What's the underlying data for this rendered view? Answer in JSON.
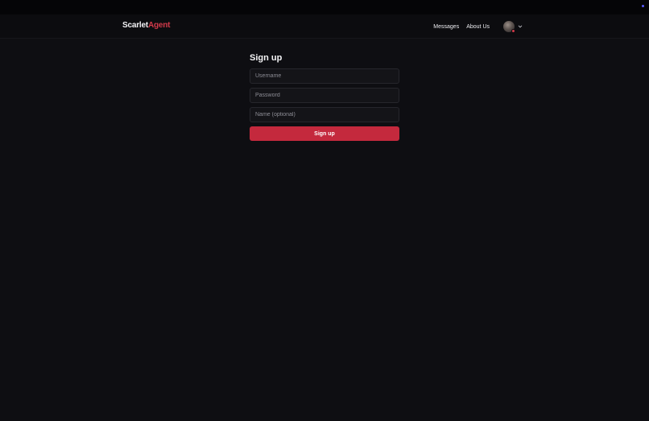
{
  "brand": {
    "part1": "Scarlet",
    "part2": "Agent"
  },
  "nav": {
    "messages": "Messages",
    "about": "About Us"
  },
  "signup": {
    "title": "Sign up",
    "username_placeholder": "Username",
    "password_placeholder": "Password",
    "name_placeholder": "Name (optional)",
    "submit_label": "Sign up"
  },
  "colors": {
    "accent": "#c4293d",
    "brand_accent": "#d23a4a",
    "background": "#0e0e12"
  }
}
